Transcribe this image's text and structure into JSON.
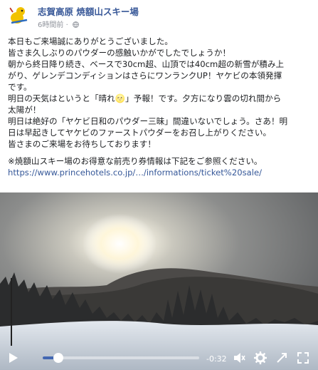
{
  "post": {
    "page_name": "志賀高原 焼額山スキー場",
    "timestamp": "6時間前",
    "lines": [
      "本日もご来場誠にありがとうございました。",
      "皆さま久しぶりのパウダーの感触いかがでしたでしょうか！",
      "朝から終日降り続き、ベースで30cm超、山頂では40cm超の新雪が積み上",
      "がり、ゲレンデコンディションはさらにワンランクUP！ヤケビの本領発揮",
      "です。",
      "明日の天気はというと「晴れ🌝」予報！です。夕方になり雲の切れ間から",
      "太陽が！",
      "明日は絶好の「ヤケビ日和のパウダー三昧」間違いないでしょう。さあ！明",
      "日は早起きしてヤケビのファーストパウダーをお召し上がりください。",
      "皆さまのご来場をお待ちしております！"
    ],
    "ticket_note": "※焼額山スキー場のお得意な前売り券情報は下記をご参照ください。",
    "link": "https://www.princehotels.co.jp/…/informations/ticket%20sale/"
  },
  "video": {
    "time_remaining": "-0:32",
    "progress": 0.1
  },
  "colors": {
    "link": "#365899",
    "page_name": "#385898",
    "progress_played": "#4267b2"
  },
  "icons": {
    "play": "play-icon",
    "volume": "volume-icon",
    "settings": "gear-icon",
    "expand": "expand-icon",
    "fullscreen": "fullscreen-icon"
  }
}
